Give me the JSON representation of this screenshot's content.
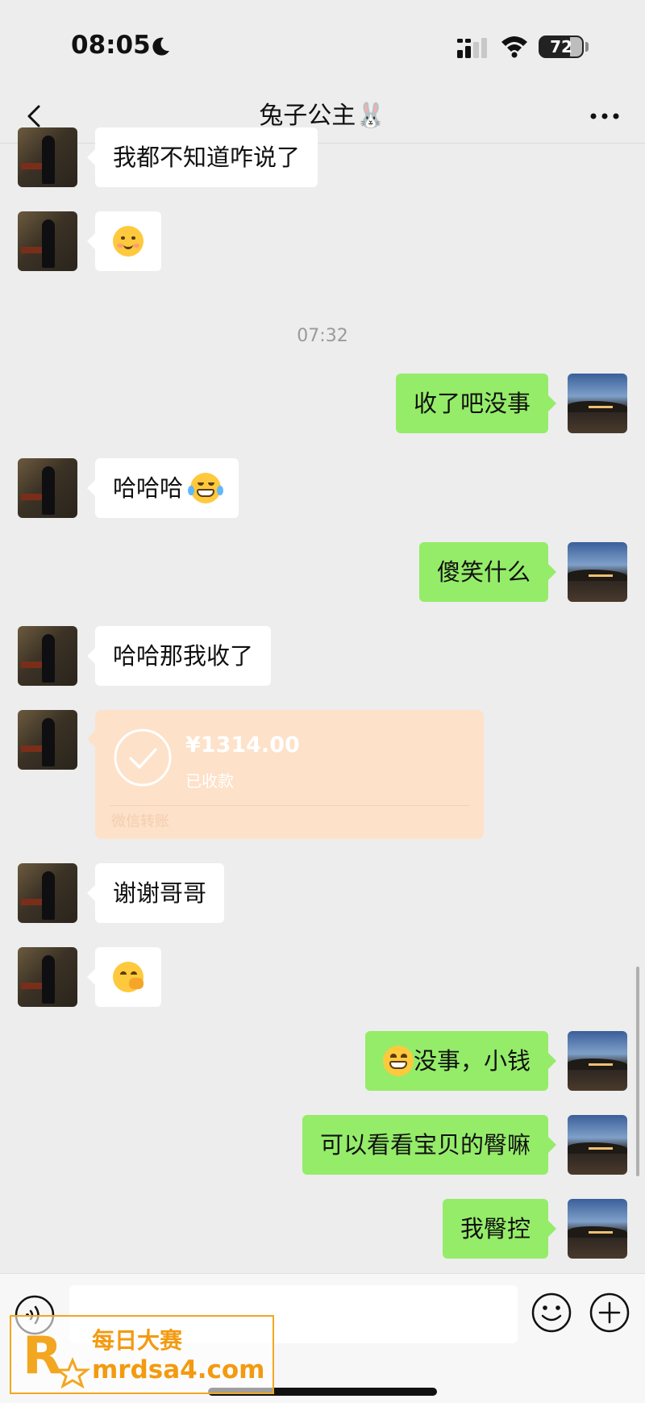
{
  "status_bar": {
    "time": "08:05",
    "battery": "72",
    "battery_level": 0.72,
    "icons": [
      "moon-icon",
      "signal-icon",
      "wifi-icon",
      "battery-icon"
    ]
  },
  "header": {
    "title": "兔子公主🐰",
    "back_icon": "chevron-left-icon",
    "more_icon": "more-icon"
  },
  "messages": [
    {
      "side": "left",
      "text": "我都不知道咋说了"
    },
    {
      "side": "left",
      "text": "",
      "emoji": "smiling-face-emoji"
    },
    {
      "type": "time",
      "text": "07:32"
    },
    {
      "side": "right",
      "text": "收了吧没事"
    },
    {
      "side": "left",
      "text": "哈哈哈",
      "emoji": "tears-of-joy-emoji"
    },
    {
      "side": "right",
      "text": "傻笑什么"
    },
    {
      "side": "left",
      "text": "哈哈那我收了"
    },
    {
      "side": "left",
      "type": "transfer",
      "amount": "¥1314.00",
      "status": "已收款",
      "label": "微信转账"
    },
    {
      "side": "left",
      "text": "谢谢哥哥"
    },
    {
      "side": "left",
      "text": "",
      "emoji": "hand-over-mouth-emoji"
    },
    {
      "side": "right",
      "text": "没事，小钱",
      "emoji": "grinning-emoji"
    },
    {
      "side": "right",
      "text": "可以看看宝贝的臀嘛"
    },
    {
      "side": "right",
      "text": "我臀控"
    }
  ],
  "input_bar": {
    "placeholder": "",
    "icons": [
      "voice-icon",
      "emoji-icon",
      "plus-icon"
    ]
  },
  "watermark": {
    "title": "每日大赛",
    "url": "mrdsa4.com"
  },
  "colors": {
    "background": "#ededed",
    "own_bubble": "#95ec69",
    "other_bubble": "#ffffff",
    "transfer_card": "#fde1c8"
  }
}
